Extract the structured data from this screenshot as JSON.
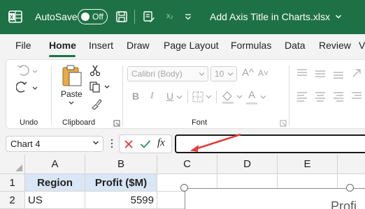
{
  "titlebar": {
    "autosave_label": "AutoSave",
    "toggle_state": "Off",
    "document_title": "Add Axis Title in Charts.xlsx",
    "subscript_glyph": "x₂",
    "brand_color": "#1e7145"
  },
  "menu": {
    "tabs": [
      "File",
      "Home",
      "Insert",
      "Draw",
      "Page Layout",
      "Formulas",
      "Data",
      "Review",
      "V"
    ],
    "active_tab": "Home"
  },
  "ribbon": {
    "groups": {
      "undo": "Undo",
      "clipboard": "Clipboard",
      "font": "Font"
    },
    "paste_label": "Paste",
    "font_name": "Calibri (Body)",
    "font_size": "10",
    "bold": "B",
    "italic": "I",
    "underline": "U",
    "grow_font": "A^",
    "shrink_font": "A˅",
    "font_color_letter": "A"
  },
  "formula_bar": {
    "name_box": "Chart 4",
    "fx": "fx",
    "value": ""
  },
  "sheet": {
    "columns": [
      "A",
      "B",
      "C",
      "D",
      "E"
    ],
    "rows": [
      "1",
      "2"
    ],
    "cells": {
      "A1": "Region",
      "B1": "Profit ($M)",
      "A2": "US",
      "B2": "5599"
    },
    "chart_title_partial": "Profi"
  }
}
